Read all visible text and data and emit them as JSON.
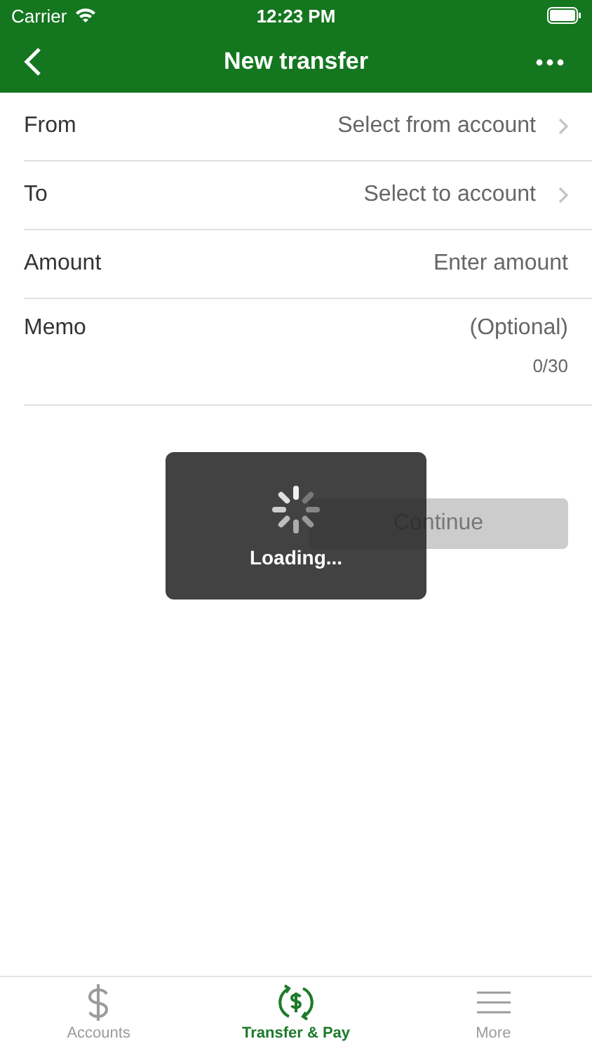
{
  "status_bar": {
    "carrier": "Carrier",
    "time": "12:23 PM"
  },
  "nav": {
    "title": "New transfer"
  },
  "fields": [
    {
      "label": "From",
      "value": "Select from account",
      "kind": "select"
    },
    {
      "label": "To",
      "value": "Select to account",
      "kind": "select"
    },
    {
      "label": "Amount",
      "placeholder": "Enter amount",
      "kind": "input"
    },
    {
      "label": "Memo",
      "placeholder": "(Optional)",
      "counter": "0/30",
      "kind": "memo"
    }
  ],
  "continue_button": {
    "label": "Continue",
    "disabled": true
  },
  "loading": {
    "text": "Loading..."
  },
  "tabs": [
    {
      "label": "Accounts",
      "kind": "accounts",
      "selected": false
    },
    {
      "label": "Transfer & Pay",
      "kind": "transfer",
      "selected": true
    },
    {
      "label": "More",
      "kind": "more",
      "selected": false
    }
  ]
}
